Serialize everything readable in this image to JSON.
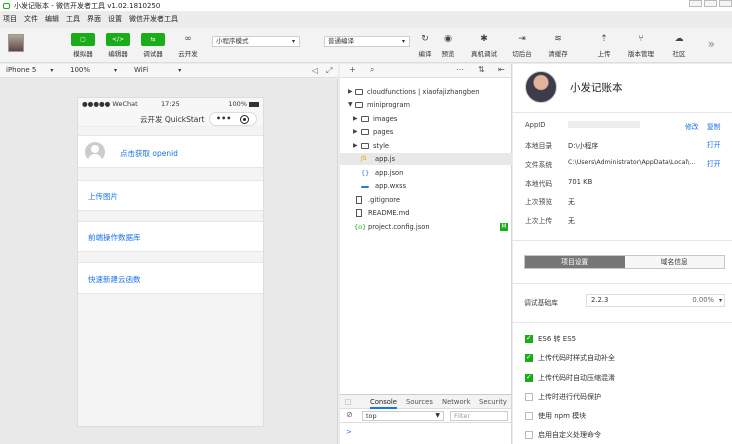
{
  "window": {
    "title": "小发记账本 - 微信开发者工具 v1.02.1810250"
  },
  "menu": [
    "项目",
    "文件",
    "编辑",
    "工具",
    "界面",
    "设置",
    "微信开发者工具"
  ],
  "toolbar": {
    "simulator": {
      "icon": "▢",
      "label": "模拟器"
    },
    "editor": {
      "icon": "</>",
      "label": "编辑器"
    },
    "debugger": {
      "icon": "⇆",
      "label": "调试器"
    },
    "cloud": {
      "icon": "∞",
      "label": "云开发"
    },
    "mode_select": "小程序模式",
    "compile_select": "普通编译",
    "compile": {
      "icon": "↻",
      "label": "编译"
    },
    "preview": {
      "icon": "◉",
      "label": "预览"
    },
    "realdebug": {
      "icon": "✱",
      "label": "真机调试"
    },
    "switch_bg": {
      "icon": "⇥",
      "label": "切后台"
    },
    "cache": {
      "icon": "≋",
      "label": "清缓存"
    },
    "upload": {
      "icon": "⇡",
      "label": "上传"
    },
    "version": {
      "icon": "⑂",
      "label": "版本管理"
    },
    "community": {
      "icon": "☁",
      "label": "社区"
    },
    "more": "»"
  },
  "simbar": {
    "device": "iPhone 5",
    "zoom": "100%",
    "network": "WiFi"
  },
  "phone": {
    "carrier": "●●●●● WeChat",
    "time": "17:25",
    "battery": "100%",
    "title": "云开发 QuickStart",
    "capsule_dots": "•••",
    "cards": [
      {
        "label": "点击获取 openid"
      },
      {
        "label": "上传图片"
      },
      {
        "label": "前端操作数据库"
      },
      {
        "label": "快速新建云函数"
      }
    ]
  },
  "explorer": {
    "items": [
      {
        "label": "cloudfunctions | xiaofajizhangben",
        "type": "folder",
        "arrow": "▶"
      },
      {
        "label": "miniprogram",
        "type": "folder",
        "arrow": "▼"
      },
      {
        "label": "images",
        "type": "folder",
        "arrow": "▶"
      },
      {
        "label": "pages",
        "type": "folder",
        "arrow": "▶"
      },
      {
        "label": "style",
        "type": "folder",
        "arrow": "▶"
      },
      {
        "label": "app.js",
        "type": "js",
        "icon": "JS"
      },
      {
        "label": "app.json",
        "type": "json",
        "icon": "{}"
      },
      {
        "label": "app.wxss",
        "type": "wxss",
        "icon": ""
      },
      {
        "label": ".gitignore",
        "type": "file",
        "icon": ""
      },
      {
        "label": "README.md",
        "type": "file",
        "icon": ""
      },
      {
        "label": "project.config.json",
        "type": "cfg",
        "icon": "{o}"
      }
    ],
    "badge": "M"
  },
  "console": {
    "tabs": [
      "Console",
      "Sources",
      "Network",
      "Security"
    ],
    "context": "top",
    "filter_placeholder": "Filter",
    "prompt": ">"
  },
  "project": {
    "name": "小发记账本",
    "appid_label": "AppID",
    "appid_value": "",
    "modify": "修改",
    "copy": "复制",
    "localdir_label": "本地目录",
    "localdir_value": "D:\\小程序",
    "open": "打开",
    "filesys_label": "文件系统",
    "filesys_value": "C:\\Users\\Administrator\\AppData\\Local\\...",
    "code_label": "本地代码",
    "code_value": "701 KB",
    "lastpreview_label": "上次预览",
    "lastpreview_value": "无",
    "lastupload_label": "上次上传",
    "lastupload_value": "无",
    "tab_settings": "项目设置",
    "tab_domain": "域名信息",
    "baselib_label": "调试基础库",
    "baselib_value": "2.2.3",
    "baselib_pct": "0.00%",
    "options": [
      {
        "label": "ES6 转 ES5",
        "checked": true
      },
      {
        "label": "上传代码时样式自动补全",
        "checked": true
      },
      {
        "label": "上传代码时自动压缩混淆",
        "checked": true
      },
      {
        "label": "上传时进行代码保护",
        "checked": false
      },
      {
        "label": "使用 npm 模块",
        "checked": false
      },
      {
        "label": "启用自定义处理命令",
        "checked": false
      }
    ]
  }
}
